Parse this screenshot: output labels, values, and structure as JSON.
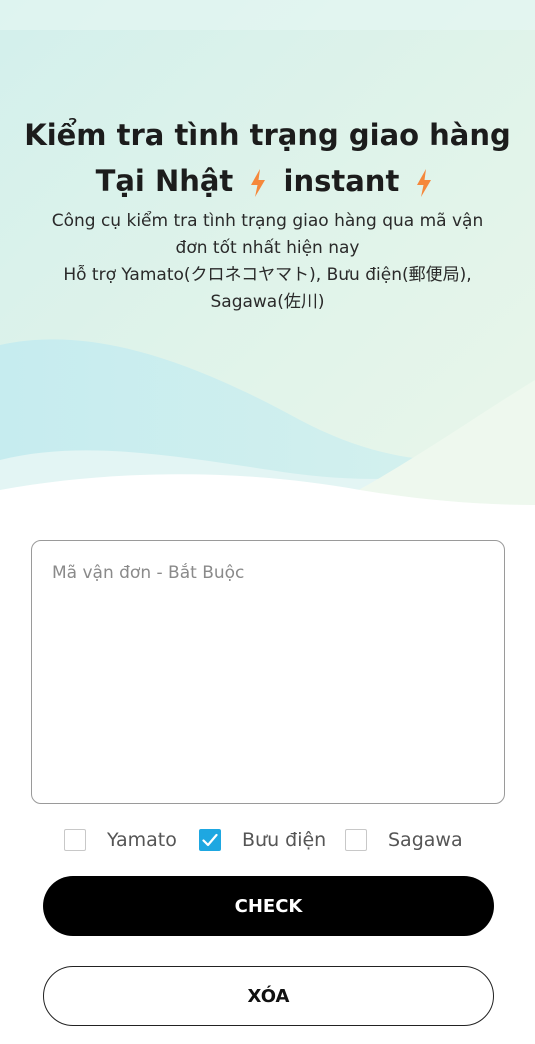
{
  "hero": {
    "title_line1": "Kiểm tra tình trạng giao hàng",
    "title_line2_prefix": "Tại Nhật",
    "title_line2_suffix": "instant",
    "subtitle_line1": "Công cụ kiểm tra tình trạng giao hàng qua mã vận",
    "subtitle_line2": "đơn tốt nhất hiện nay",
    "subtitle_line3": "Hỗ trợ Yamato(クロネコヤマト), Bưu điện(郵便局),",
    "subtitle_line4": "Sagawa(佐川)",
    "bolt_icon": "lightning-bolt-icon",
    "bolt_color": "#f5883b"
  },
  "form": {
    "tracking_placeholder": "Mã vận đơn - Bắt Buộc",
    "tracking_value": "",
    "carriers": [
      {
        "label": "Yamato",
        "checked": false
      },
      {
        "label": "Bưu điện",
        "checked": true
      },
      {
        "label": "Sagawa",
        "checked": false
      }
    ],
    "check_color": "#1ea7e1"
  },
  "actions": {
    "check_label": "CHECK",
    "clear_label": "XÓA"
  }
}
